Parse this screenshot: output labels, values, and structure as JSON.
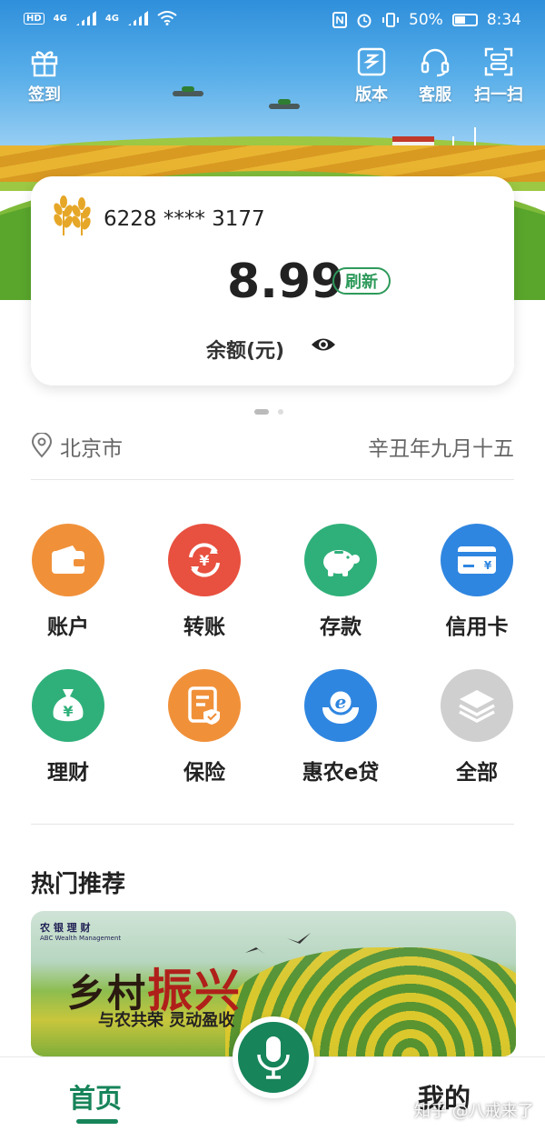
{
  "status_bar": {
    "hd": "HD",
    "net1": "4G",
    "net2": "4G",
    "battery": "50%",
    "time": "8:34"
  },
  "header": {
    "signin_label": "签到",
    "version_label": "版本",
    "service_label": "客服",
    "scan_label": "扫一扫"
  },
  "account_card": {
    "account_number": "6228 **** 3177",
    "balance": "8.99",
    "refresh_label": "刷新",
    "balance_label": "余额(元)"
  },
  "location": {
    "city": "北京市",
    "lunar_date": "辛丑年九月十五"
  },
  "services": [
    {
      "label": "账户",
      "icon": "wallet-icon",
      "color": "#f0913a"
    },
    {
      "label": "转账",
      "icon": "transfer-icon",
      "color": "#e8503f"
    },
    {
      "label": "存款",
      "icon": "piggy-bank-icon",
      "color": "#2fb07a"
    },
    {
      "label": "信用卡",
      "icon": "credit-card-icon",
      "color": "#2f86e0"
    },
    {
      "label": "理财",
      "icon": "money-bag-icon",
      "color": "#2fb07a"
    },
    {
      "label": "保险",
      "icon": "insurance-icon",
      "color": "#f0913a"
    },
    {
      "label": "惠农e贷",
      "icon": "e-loan-icon",
      "color": "#2f86e0"
    },
    {
      "label": "全部",
      "icon": "layers-icon",
      "color": "#cfcfcf"
    }
  ],
  "recommend": {
    "title": "热门推荐",
    "banner_logo": "农 银 理 财",
    "banner_logo_sub": "ABC Wealth Management",
    "banner_slogan_a": "乡村",
    "banner_slogan_b": "振兴",
    "banner_tagline": "与农共荣 灵动盈收"
  },
  "bottom_nav": {
    "home_label": "首页",
    "mine_label": "我的"
  },
  "watermark": "知乎 @八戒来了",
  "colors": {
    "brand_green": "#17845a",
    "refresh_green": "#2e9a5b"
  }
}
